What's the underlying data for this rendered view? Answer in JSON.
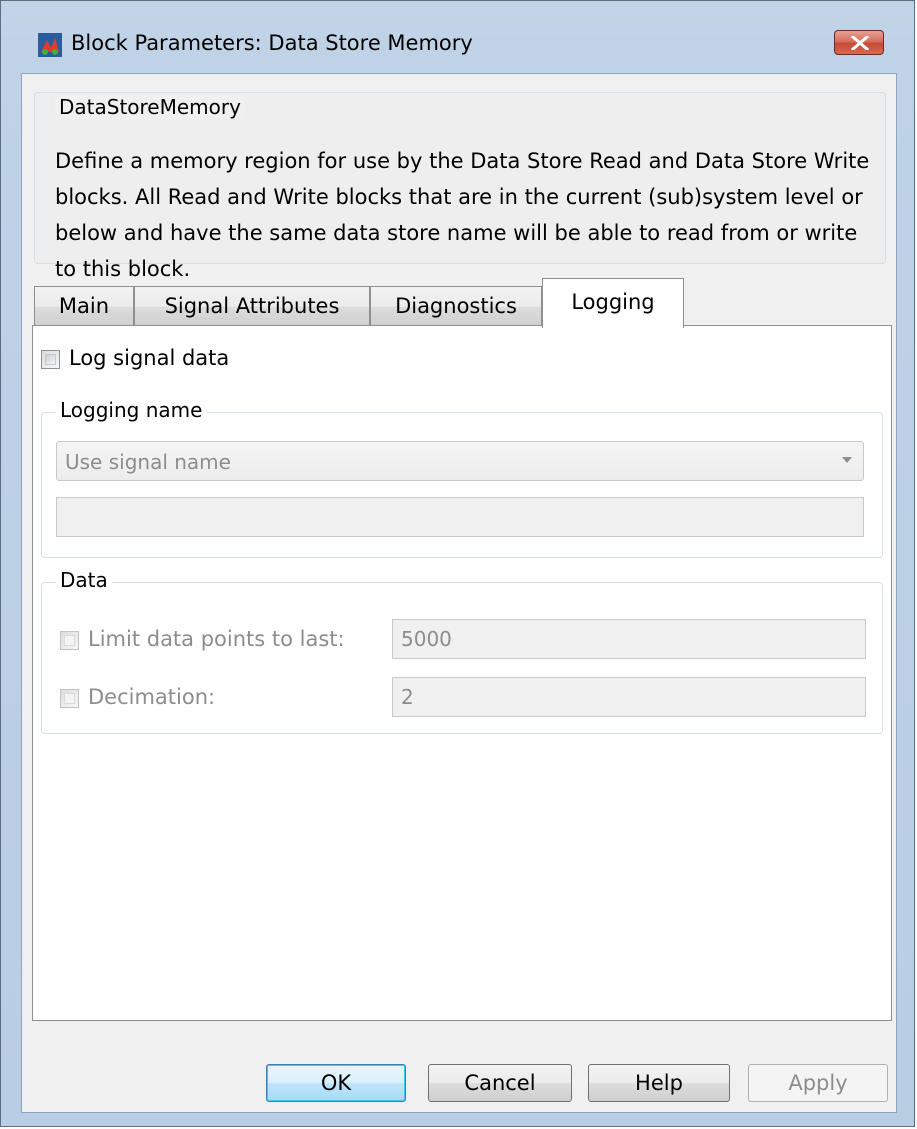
{
  "window": {
    "title": "Block Parameters: Data Store Memory"
  },
  "description": {
    "legend": "DataStoreMemory",
    "text": "Define a memory region for use by the Data Store Read and Data Store Write blocks. All Read and Write blocks that are in the current (sub)system level or below and have the same data store name will be able to read from or write to this block."
  },
  "tabs": [
    {
      "label": "Main"
    },
    {
      "label": "Signal Attributes"
    },
    {
      "label": "Diagnostics"
    },
    {
      "label": "Logging"
    }
  ],
  "active_tab": "Logging",
  "logging": {
    "log_signal_label": "Log signal data",
    "log_signal_checked": false,
    "logging_name_group": "Logging name",
    "logging_name_select": "Use signal name",
    "logging_name_value": "",
    "data_group": "Data",
    "limit_label": "Limit data points to last:",
    "limit_checked": false,
    "limit_value": "5000",
    "decimation_label": "Decimation:",
    "decimation_checked": false,
    "decimation_value": "2"
  },
  "buttons": {
    "ok": "OK",
    "cancel": "Cancel",
    "help": "Help",
    "apply": "Apply"
  }
}
